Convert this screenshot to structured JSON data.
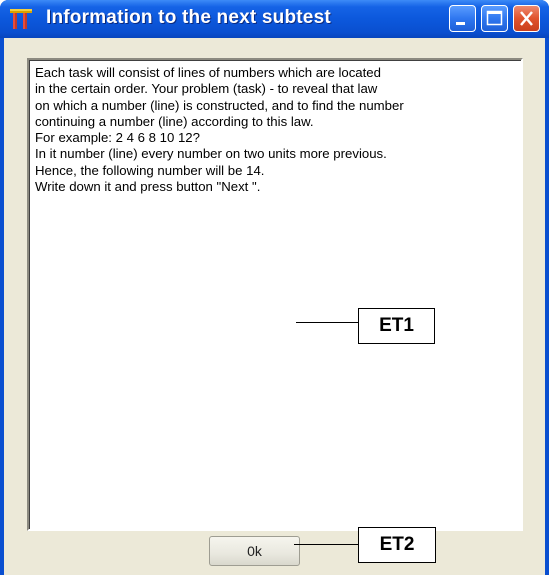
{
  "window": {
    "title": "Information to the next subtest",
    "titlebar_color": "#0a4fd0",
    "close_color": "#e0532d"
  },
  "memo": {
    "lines": [
      "Each task will consist of lines of numbers which are located",
      "in the certain order. Your problem (task)  - to reveal that law",
      "on which a number (line) is constructed, and to find the number",
      "continuing a number (line) according to this law.",
      "For example: 2 4 6 8 10 12?",
      "In it number (line) every number on two units more previous.",
      "Hence, the following number will be 14.",
      "Write down it and press button \"Next \"."
    ]
  },
  "buttons": {
    "ok_label": "0k"
  },
  "annotations": {
    "et1": "ET1",
    "et2": "ET2"
  },
  "icons": {
    "app": "app-icon",
    "minimize": "minimize-icon",
    "maximize": "maximize-icon",
    "close": "close-icon"
  }
}
